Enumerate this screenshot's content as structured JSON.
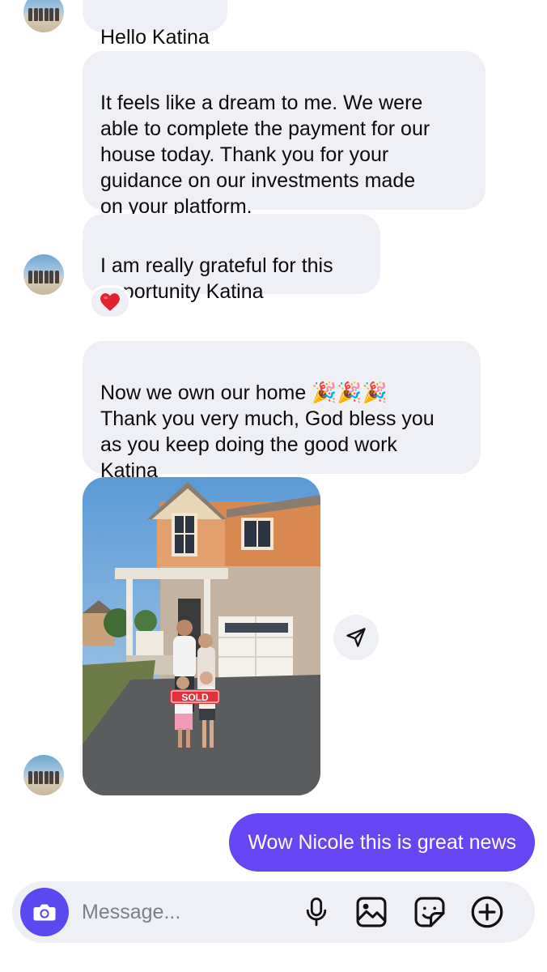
{
  "conversation": {
    "messages": [
      {
        "direction": "incoming",
        "text": "Hello Katina"
      },
      {
        "direction": "incoming",
        "text": "It feels like a dream to me. We were\nable to complete the payment for our\nhouse today. Thank you for your\nguidance on our investments made\non your platform."
      },
      {
        "direction": "incoming",
        "text": "I am really grateful for this\nopportunity Katina",
        "reaction": "❤️"
      },
      {
        "direction": "incoming",
        "text": "Now we own our home 🎉🎉🎉\nThank you very much, God bless you\nas you keep doing the good work\nKatina"
      },
      {
        "direction": "incoming",
        "type": "photo",
        "sign_text": "SOLD"
      },
      {
        "direction": "outgoing",
        "text": "Wow Nicole this is great news"
      }
    ]
  },
  "composer": {
    "placeholder": "Message...",
    "icons": [
      "camera-icon",
      "microphone-icon",
      "gallery-icon",
      "sticker-icon",
      "add-icon"
    ]
  },
  "colors": {
    "accent": "#6646f3",
    "camera_button": "#5a48f0",
    "incoming_bubble": "#eff0f5",
    "reaction_heart": "#e3222d"
  }
}
